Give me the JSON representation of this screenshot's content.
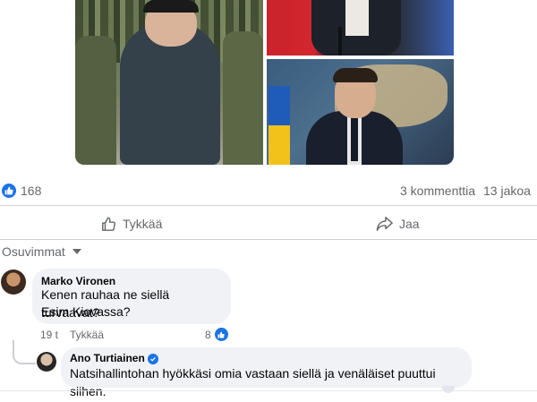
{
  "post": {
    "photos": [
      {
        "name": "left-photo"
      },
      {
        "name": "top-right-photo"
      },
      {
        "name": "bottom-right-photo"
      }
    ]
  },
  "stats": {
    "like_count": "168",
    "comments": "3 kommenttia",
    "shares": "13 jakoa"
  },
  "actions": {
    "like_label": "Tykkää",
    "share_label": "Jaa"
  },
  "comments_section": {
    "sort_label": "Osuvimmat"
  },
  "comments": [
    {
      "author": "Marko Vironen",
      "lines": [
        "Kenen rauhaa ne siellä turvaavat?",
        "Esim Kiovassa?"
      ],
      "time": "19 t",
      "like_action": "Tykkää",
      "likes": "8"
    }
  ],
  "replies": [
    {
      "author": "Ano Turtiainen",
      "verified": true,
      "text": "Natsihallintohan hyökkäsi omia vastaan siellä ja venäläiset puuttui siihen."
    }
  ],
  "colors": {
    "accent": "#1b74e4",
    "bubble": "#f0f2f5",
    "secondary_text": "#65676b"
  }
}
